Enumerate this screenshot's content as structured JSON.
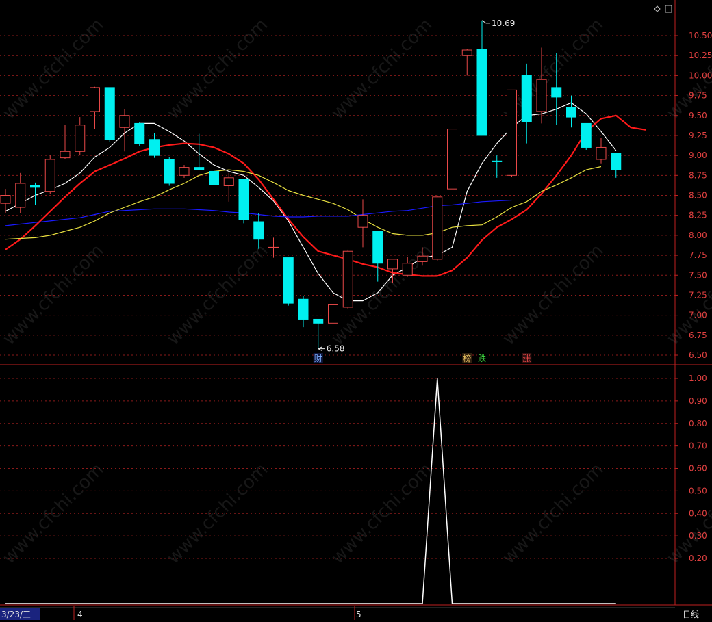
{
  "colors": {
    "up": "#e84848",
    "down": "#00f0f0",
    "ma5": "#ffffff",
    "ma10": "#ff1a1a",
    "ma20": "#e8e040",
    "ma60": "#1a1aff",
    "grid": "#8b1a1a",
    "axis": "#c02020"
  },
  "chart_data": [
    {
      "type": "candlestick",
      "yticks": [
        "10.50",
        "10.25",
        "10.00",
        "9.75",
        "9.50",
        "9.25",
        "9.00",
        "8.75",
        "8.50",
        "8.25",
        "8.00",
        "7.75",
        "7.50",
        "7.25",
        "7.00",
        "6.75",
        "6.50"
      ],
      "ylim": [
        6.42,
        10.84
      ],
      "candles": [
        {
          "o": 8.4,
          "h": 8.58,
          "l": 8.28,
          "c": 8.5
        },
        {
          "o": 8.35,
          "h": 8.78,
          "l": 8.28,
          "c": 8.65
        },
        {
          "o": 8.62,
          "h": 8.66,
          "l": 8.38,
          "c": 8.6
        },
        {
          "o": 8.55,
          "h": 9.0,
          "l": 8.52,
          "c": 8.95
        },
        {
          "o": 8.97,
          "h": 9.38,
          "l": 8.95,
          "c": 9.05
        },
        {
          "o": 9.05,
          "h": 9.48,
          "l": 9.0,
          "c": 9.38
        },
        {
          "o": 9.55,
          "h": 9.86,
          "l": 9.33,
          "c": 9.85
        },
        {
          "o": 9.85,
          "h": 9.85,
          "l": 9.17,
          "c": 9.2
        },
        {
          "o": 9.35,
          "h": 9.58,
          "l": 9.05,
          "c": 9.5
        },
        {
          "o": 9.4,
          "h": 9.42,
          "l": 9.12,
          "c": 9.15
        },
        {
          "o": 9.2,
          "h": 9.28,
          "l": 8.97,
          "c": 9.0
        },
        {
          "o": 8.95,
          "h": 8.98,
          "l": 8.62,
          "c": 8.65
        },
        {
          "o": 8.75,
          "h": 8.88,
          "l": 8.72,
          "c": 8.85
        },
        {
          "o": 8.85,
          "h": 9.27,
          "l": 8.84,
          "c": 8.82
        },
        {
          "o": 8.8,
          "h": 9.05,
          "l": 8.58,
          "c": 8.63
        },
        {
          "o": 8.62,
          "h": 8.78,
          "l": 8.42,
          "c": 8.72
        },
        {
          "o": 8.7,
          "h": 8.7,
          "l": 8.15,
          "c": 8.2
        },
        {
          "o": 8.17,
          "h": 8.28,
          "l": 7.83,
          "c": 7.95
        },
        {
          "o": 7.85,
          "h": 7.97,
          "l": 7.72,
          "c": 7.85
        },
        {
          "o": 7.72,
          "h": 7.72,
          "l": 7.12,
          "c": 7.15
        },
        {
          "o": 7.2,
          "h": 7.24,
          "l": 6.85,
          "c": 6.95
        },
        {
          "o": 6.95,
          "h": 6.95,
          "l": 6.58,
          "c": 6.9
        },
        {
          "o": 6.9,
          "h": 7.15,
          "l": 6.78,
          "c": 7.13
        },
        {
          "o": 7.1,
          "h": 7.82,
          "l": 7.08,
          "c": 7.8
        },
        {
          "o": 8.1,
          "h": 8.45,
          "l": 7.85,
          "c": 8.25
        },
        {
          "o": 8.05,
          "h": 8.05,
          "l": 7.42,
          "c": 7.65
        },
        {
          "o": 7.58,
          "h": 7.68,
          "l": 7.4,
          "c": 7.7
        },
        {
          "o": 7.5,
          "h": 7.73,
          "l": 7.48,
          "c": 7.65
        },
        {
          "o": 7.67,
          "h": 7.85,
          "l": 7.62,
          "c": 7.74
        },
        {
          "o": 7.7,
          "h": 8.5,
          "l": 7.68,
          "c": 8.48
        },
        {
          "o": 8.58,
          "h": 9.33,
          "l": 8.58,
          "c": 9.33
        },
        {
          "o": 10.25,
          "h": 10.33,
          "l": 10.0,
          "c": 10.32
        },
        {
          "o": 10.33,
          "h": 10.69,
          "l": 9.25,
          "c": 9.25
        },
        {
          "o": 8.93,
          "h": 9.0,
          "l": 8.72,
          "c": 8.92
        },
        {
          "o": 8.75,
          "h": 9.82,
          "l": 8.73,
          "c": 9.82
        },
        {
          "o": 10.0,
          "h": 10.15,
          "l": 9.15,
          "c": 9.42
        },
        {
          "o": 9.55,
          "h": 10.35,
          "l": 9.4,
          "c": 9.95
        },
        {
          "o": 9.85,
          "h": 10.28,
          "l": 9.38,
          "c": 9.73
        },
        {
          "o": 9.6,
          "h": 9.75,
          "l": 9.35,
          "c": 9.48
        },
        {
          "o": 9.4,
          "h": 9.4,
          "l": 9.07,
          "c": 9.1
        },
        {
          "o": 8.95,
          "h": 9.22,
          "l": 8.9,
          "c": 9.1
        },
        {
          "o": 9.03,
          "h": 9.03,
          "l": 8.72,
          "c": 8.82
        }
      ],
      "ma_lines": [
        {
          "key": "ma5",
          "color": "#ffffff",
          "values": [
            8.3,
            8.4,
            8.5,
            8.57,
            8.65,
            8.78,
            8.98,
            9.1,
            9.28,
            9.4,
            9.4,
            9.3,
            9.18,
            9.02,
            8.88,
            8.8,
            8.75,
            8.6,
            8.43,
            8.18,
            7.85,
            7.52,
            7.28,
            7.18,
            7.18,
            7.28,
            7.5,
            7.6,
            7.72,
            7.75,
            7.85,
            8.55,
            8.9,
            9.15,
            9.35,
            9.5,
            9.52,
            9.58,
            9.66,
            9.52,
            9.3,
            9.06
          ]
        },
        {
          "key": "ma10",
          "color": "#ff1a1a",
          "values": [
            7.82,
            7.95,
            8.12,
            8.3,
            8.48,
            8.65,
            8.8,
            8.88,
            8.96,
            9.05,
            9.1,
            9.13,
            9.15,
            9.14,
            9.1,
            9.02,
            8.9,
            8.7,
            8.45,
            8.2,
            7.98,
            7.8,
            7.75,
            7.7,
            7.64,
            7.6,
            7.53,
            7.51,
            7.49,
            7.49,
            7.56,
            7.72,
            7.94,
            8.1,
            8.2,
            8.32,
            8.52,
            8.75,
            9.0,
            9.3,
            9.46,
            9.5,
            9.35,
            9.32
          ]
        },
        {
          "key": "ma20",
          "color": "#e8e040",
          "values": [
            7.95,
            7.96,
            7.97,
            8.0,
            8.05,
            8.1,
            8.18,
            8.28,
            8.35,
            8.42,
            8.48,
            8.57,
            8.65,
            8.75,
            8.8,
            8.82,
            8.8,
            8.75,
            8.66,
            8.56,
            8.5,
            8.45,
            8.4,
            8.32,
            8.2,
            8.1,
            8.02,
            8.0,
            8.0,
            8.03,
            8.1,
            8.12,
            8.13,
            8.23,
            8.35,
            8.42,
            8.55,
            8.63,
            8.72,
            8.82,
            8.86
          ]
        },
        {
          "key": "ma60",
          "color": "#1a1aff",
          "values": [
            8.12,
            8.14,
            8.16,
            8.18,
            8.2,
            8.22,
            8.26,
            8.3,
            8.31,
            8.32,
            8.33,
            8.33,
            8.33,
            8.32,
            8.31,
            8.29,
            8.28,
            8.26,
            8.24,
            8.23,
            8.23,
            8.24,
            8.24,
            8.24,
            8.26,
            8.28,
            8.3,
            8.31,
            8.34,
            8.37,
            8.38,
            8.4,
            8.42,
            8.43,
            8.44
          ]
        }
      ],
      "annotations": {
        "high_label": "10.69",
        "low_label": "6.58"
      },
      "events": [
        {
          "text": "财",
          "index": 21,
          "color": "#7fb0ff",
          "bg": "#101840"
        },
        {
          "text": "榜",
          "index": 31,
          "color": "#e8c060",
          "bg": "#302010"
        },
        {
          "text": "跌",
          "index": 32,
          "color": "#40e040",
          "bg": "#000000"
        },
        {
          "text": "涨",
          "index": 35,
          "color": "#e84848",
          "bg": "#301010"
        }
      ]
    },
    {
      "type": "line",
      "yticks": [
        "1.00",
        "0.90",
        "0.80",
        "0.70",
        "0.60",
        "0.50",
        "0.40",
        "0.30",
        "0.20"
      ],
      "ylim": [
        0,
        1.0
      ],
      "values": [
        0,
        0,
        0,
        0,
        0,
        0,
        0,
        0,
        0,
        0,
        0,
        0,
        0,
        0,
        0,
        0,
        0,
        0,
        0,
        0,
        0,
        0,
        0,
        0,
        0,
        0,
        0,
        0,
        0,
        1.0,
        0,
        0,
        0,
        0,
        0,
        0,
        0,
        0,
        0,
        0,
        0,
        0
      ]
    }
  ],
  "bottom_bar": {
    "date_label": "3/23/三",
    "month_4": "4",
    "month_5": "5",
    "period": "日线"
  },
  "watermark": "www.cfchi.com"
}
